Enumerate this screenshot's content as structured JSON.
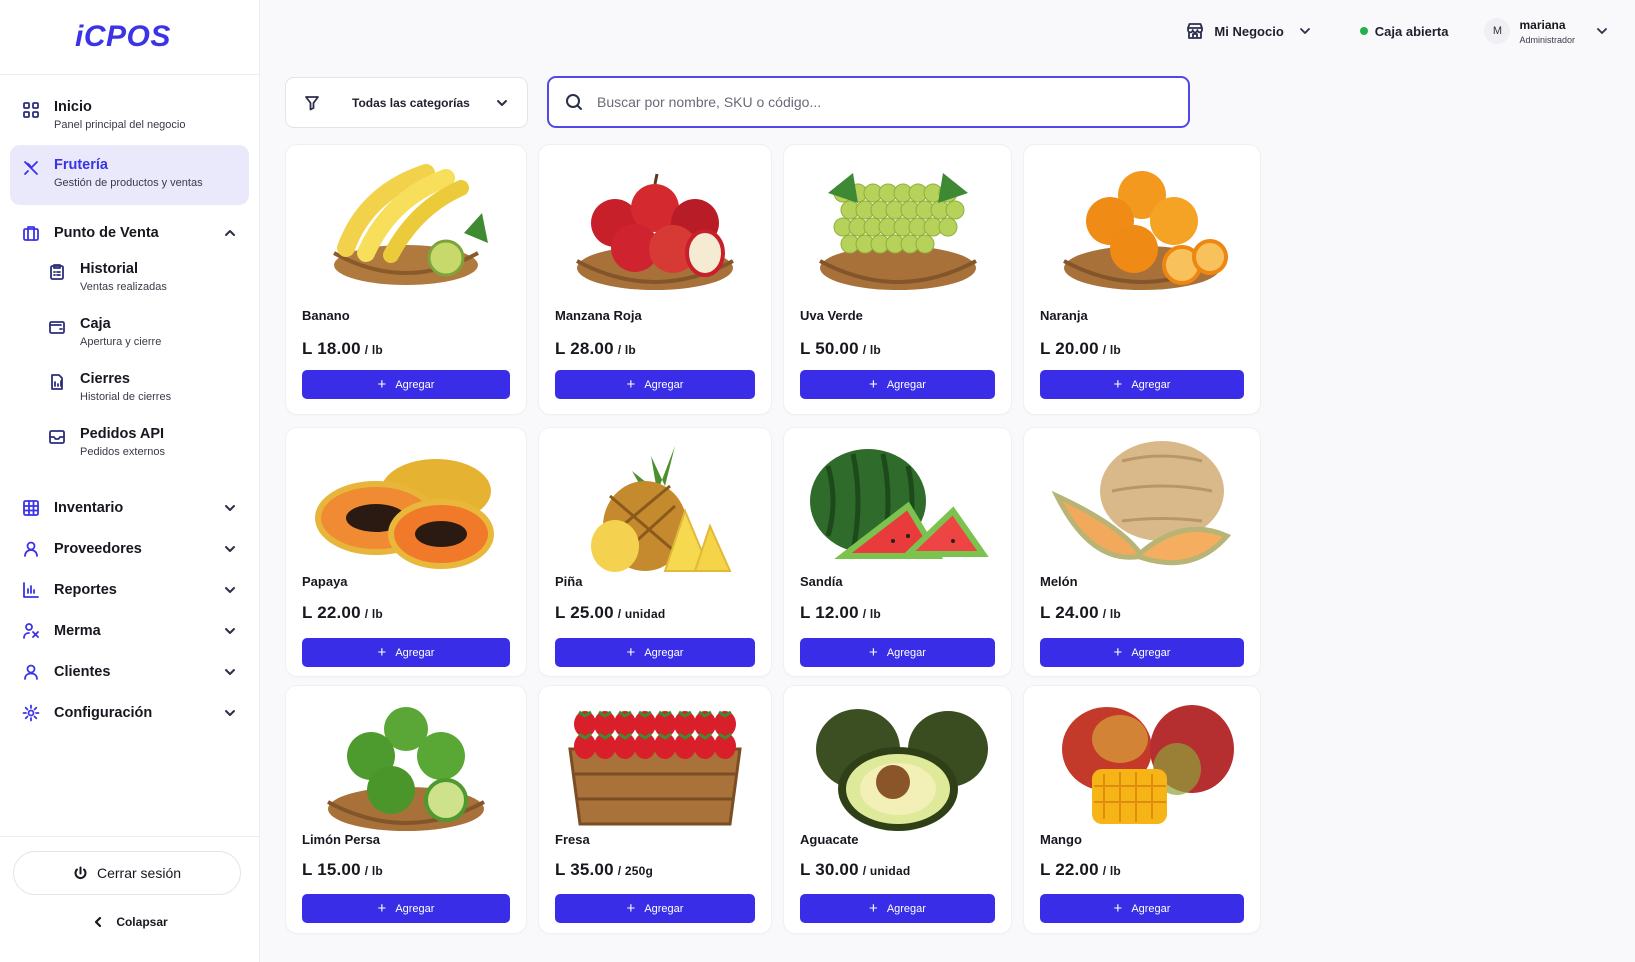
{
  "app": {
    "logo": "iCPOS"
  },
  "sidebar": {
    "top_items": [
      {
        "title": "Inicio",
        "subtitle": "Panel principal del negocio",
        "icon": "grid-icon"
      },
      {
        "title": "Frutería",
        "subtitle": "Gestión de productos y ventas",
        "icon": "fruit-knife-icon",
        "active": true
      }
    ],
    "pos": {
      "title": "Punto de Venta",
      "children": [
        {
          "title": "Historial",
          "subtitle": "Ventas realizadas",
          "icon": "clipboard-icon"
        },
        {
          "title": "Caja",
          "subtitle": "Apertura y cierre",
          "icon": "wallet-icon"
        },
        {
          "title": "Cierres",
          "subtitle": "Historial de cierres",
          "icon": "document-icon"
        },
        {
          "title": "Pedidos API",
          "subtitle": "Pedidos externos",
          "icon": "inbox-icon"
        }
      ]
    },
    "groups": [
      {
        "title": "Inventario",
        "icon": "table-icon"
      },
      {
        "title": "Proveedores",
        "icon": "supplier-icon"
      },
      {
        "title": "Reportes",
        "icon": "bar-chart-icon"
      },
      {
        "title": "Merma",
        "icon": "users-waste-icon"
      },
      {
        "title": "Clientes",
        "icon": "user-icon"
      },
      {
        "title": "Configuración",
        "icon": "gear-icon"
      }
    ],
    "logout": "Cerrar sesión",
    "collapse": "Colapsar"
  },
  "topbar": {
    "business": "Mi Negocio",
    "cash_status": "Caja abierta",
    "cash_status_color": "#22b14c",
    "user_initial": "M",
    "user_name": "mariana",
    "user_role": "Administrador"
  },
  "filters": {
    "category": "Todas las categorías",
    "search_placeholder": "Buscar por nombre, SKU o código..."
  },
  "theme": {
    "accent": "#3a2de8",
    "active_bg": "#e9e9fb"
  },
  "add_label": "Agregar",
  "products": [
    {
      "name": "Banano",
      "price": "L 18.00",
      "unit": "/ lb",
      "icon": "banana-basket-image"
    },
    {
      "name": "Manzana Roja",
      "price": "L 28.00",
      "unit": "/ lb",
      "icon": "apple-basket-image"
    },
    {
      "name": "Uva Verde",
      "price": "L 50.00",
      "unit": "/ lb",
      "icon": "grape-basket-image"
    },
    {
      "name": "Naranja",
      "price": "L 20.00",
      "unit": "/ lb",
      "icon": "orange-basket-image"
    },
    {
      "name": "Papaya",
      "price": "L 22.00",
      "unit": "/ lb",
      "icon": "papaya-image"
    },
    {
      "name": "Piña",
      "price": "L 25.00",
      "unit": "/ unidad",
      "icon": "pineapple-image"
    },
    {
      "name": "Sandía",
      "price": "L 12.00",
      "unit": "/ lb",
      "icon": "watermelon-image"
    },
    {
      "name": "Melón",
      "price": "L 24.00",
      "unit": "/ lb",
      "icon": "melon-image"
    },
    {
      "name": "Limón Persa",
      "price": "L 15.00",
      "unit": "/ lb",
      "icon": "lime-basket-image"
    },
    {
      "name": "Fresa",
      "price": "L 35.00",
      "unit": "/ 250g",
      "icon": "strawberry-crate-image"
    },
    {
      "name": "Aguacate",
      "price": "L 30.00",
      "unit": "/ unidad",
      "icon": "avocado-image"
    },
    {
      "name": "Mango",
      "price": "L 22.00",
      "unit": "/ lb",
      "icon": "mango-image"
    }
  ]
}
